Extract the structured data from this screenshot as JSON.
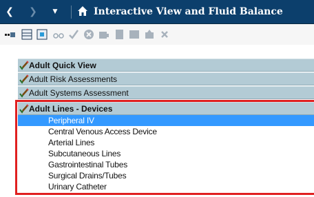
{
  "window": {
    "title": "Interactive View and Fluid Balance"
  },
  "toolbar": {
    "icons": [
      "add-row-icon",
      "table-icon",
      "grid-icon",
      "glasses-icon",
      "checkmark-icon",
      "clear-icon",
      "flag-icon",
      "document-icon",
      "sheet-icon",
      "task-icon",
      "delete-icon"
    ]
  },
  "sections": [
    {
      "label": "Adult Quick View",
      "bold": true
    },
    {
      "label": "Adult Risk Assessments",
      "bold": false
    },
    {
      "label": "Adult Systems Assessment",
      "bold": false
    },
    {
      "label": "Adult Lines - Devices",
      "bold": true
    }
  ],
  "items": [
    {
      "label": "Peripheral IV",
      "selected": true
    },
    {
      "label": "Central Venous Access Device",
      "selected": false
    },
    {
      "label": "Arterial Lines",
      "selected": false
    },
    {
      "label": "Subcutaneous Lines",
      "selected": false
    },
    {
      "label": "Gastrointestinal Tubes",
      "selected": false
    },
    {
      "label": "Surgical Drains/Tubes",
      "selected": false
    },
    {
      "label": "Urinary Catheter",
      "selected": false
    }
  ],
  "colors": {
    "titlebar": "#0c3f6c",
    "section_band": "#b3cbd5",
    "selected_row": "#3399ff",
    "highlight_box": "#e02020"
  }
}
